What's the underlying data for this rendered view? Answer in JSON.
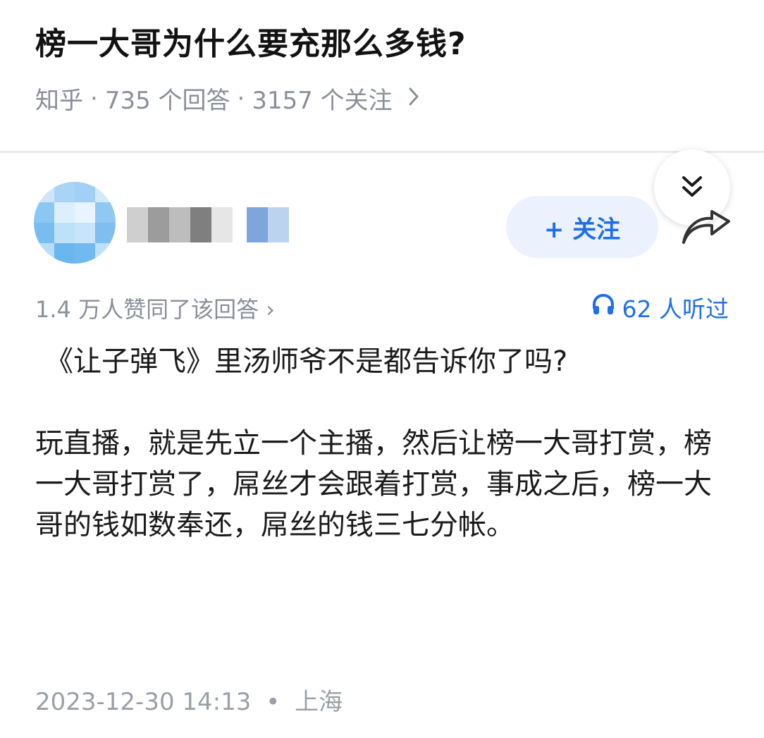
{
  "question": {
    "title": "榜一大哥为什么要充那么多钱?",
    "source": "知乎",
    "answers": "735 个回答",
    "followers": "3157 个关注",
    "separator": "·"
  },
  "author": {
    "follow_label": "+ 关注"
  },
  "answer": {
    "votes": "1.4 万人赞同了该回答 ›",
    "listen_count": "62 人听过",
    "paragraphs": [
      "《让子弹飞》里汤师爷不是都告诉你了吗?",
      "玩直播，就是先立一个主播，然后让榜一大哥打赏，榜一大哥打赏了，屌丝才会跟着打赏，事成之后，榜一大哥的钱如数奉还，屌丝的钱三七分帐。"
    ],
    "date": "2023-12-30 14:13",
    "location": "上海",
    "separator": "•"
  },
  "icons": {
    "meta_chevron": "chevron-right-icon",
    "collapse": "double-chevron-down-icon",
    "share": "share-arrow-icon",
    "listen": "headphones-icon"
  },
  "colors": {
    "accent": "#1f6feb",
    "follow_bg": "#ebf2fd",
    "meta_gray": "#8a8f99"
  }
}
